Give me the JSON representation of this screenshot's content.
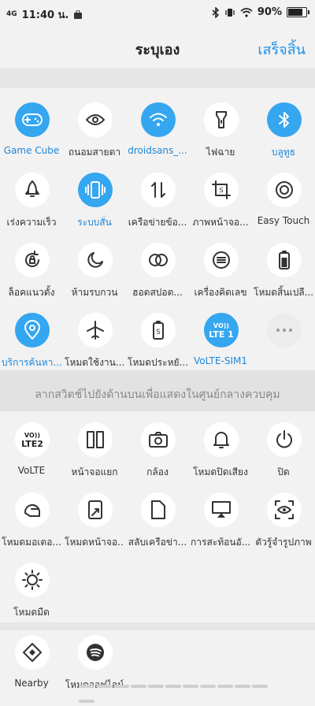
{
  "status_bar": {
    "network": "4G",
    "time": "11:40 น.",
    "battery": "90%",
    "battery_level": 0.9
  },
  "header": {
    "title": "ระบุเอง",
    "done_label": "เสร็จสิ้น"
  },
  "colors": {
    "accent": "#35a6f0",
    "accent_text": "#1f86d8",
    "done": "#1f8fe6"
  },
  "active_tiles": [
    {
      "label": "Game Cube",
      "icon": "gamepad-icon",
      "active": true
    },
    {
      "label": "ถนอมสายตา",
      "icon": "eye-icon",
      "active": false
    },
    {
      "label": "droidsans_...",
      "icon": "wifi-icon",
      "active": true
    },
    {
      "label": "ไฟฉาย",
      "icon": "flashlight-icon",
      "active": false
    },
    {
      "label": "บลูทูธ",
      "icon": "bluetooth-icon",
      "active": true
    },
    {
      "label": "เร่งความเร็ว",
      "icon": "rocket-icon",
      "active": false
    },
    {
      "label": "ระบบสั่น",
      "icon": "vibrate-icon",
      "active": true
    },
    {
      "label": "เครือข่ายข้อ...",
      "icon": "data-arrows-icon",
      "active": false
    },
    {
      "label": "ภาพหน้าจอ...",
      "icon": "screenshot-icon",
      "active": false
    },
    {
      "label": "Easy Touch",
      "icon": "easy-touch-icon",
      "active": false
    },
    {
      "label": "ล็อคแนวตั้ง",
      "icon": "rotation-lock-icon",
      "active": false
    },
    {
      "label": "ห้ามรบกวน",
      "icon": "moon-icon",
      "active": false
    },
    {
      "label": "ฮอตสปอต...",
      "icon": "hotspot-icon",
      "active": false
    },
    {
      "label": "เครื่องคิดเลข",
      "icon": "calculator-icon",
      "active": false
    },
    {
      "label": "โหมดสิ้นเปลื...",
      "icon": "battery-icon",
      "active": false
    },
    {
      "label": "บริการค้นหา...",
      "icon": "location-icon",
      "active": true
    },
    {
      "label": "โหมดใช้งาน...",
      "icon": "airplane-icon",
      "active": false
    },
    {
      "label": "โหมดประหยั...",
      "icon": "power-saver-icon",
      "active": false
    },
    {
      "label": "VoLTE-SIM1",
      "icon": "volte-lte1-icon",
      "active": true,
      "icon_text_top": "VO))",
      "icon_text_bottom": "LTE 1"
    }
  ],
  "add_tile": {
    "icon": "more-icon"
  },
  "drag_hint": "ลากสวิตช์ไปยังด้านบนเพื่อแสดงในศูนย์กลางควบคุม",
  "available_tiles": [
    {
      "label": "VoLTE",
      "icon": "volte-lte2-icon",
      "icon_text_top": "VO))",
      "icon_text_bottom": "LTE2"
    },
    {
      "label": "หน้าจอแยก",
      "icon": "split-screen-icon"
    },
    {
      "label": "กล้อง",
      "icon": "camera-icon"
    },
    {
      "label": "โหมดปิดเสียง",
      "icon": "bell-icon"
    },
    {
      "label": "ปิด",
      "icon": "power-icon"
    },
    {
      "label": "โหมดมอเตอ...",
      "icon": "helmet-icon"
    },
    {
      "label": "โหมดหน้าจอ...",
      "icon": "shrink-screen-icon"
    },
    {
      "label": "สลับเครือข่า...",
      "icon": "sim-icon"
    },
    {
      "label": "การสะท้อนอั...",
      "icon": "cast-icon"
    },
    {
      "label": "ตัวรู้จำรูปภาพ",
      "icon": "scan-eye-icon"
    },
    {
      "label": "โหมดมืด",
      "icon": "dark-mode-icon"
    }
  ],
  "third_tiles": [
    {
      "label": "Nearby",
      "icon": "nearby-icon"
    },
    {
      "label": "โหมดออฟไลน์",
      "icon": "spotify-icon"
    }
  ]
}
